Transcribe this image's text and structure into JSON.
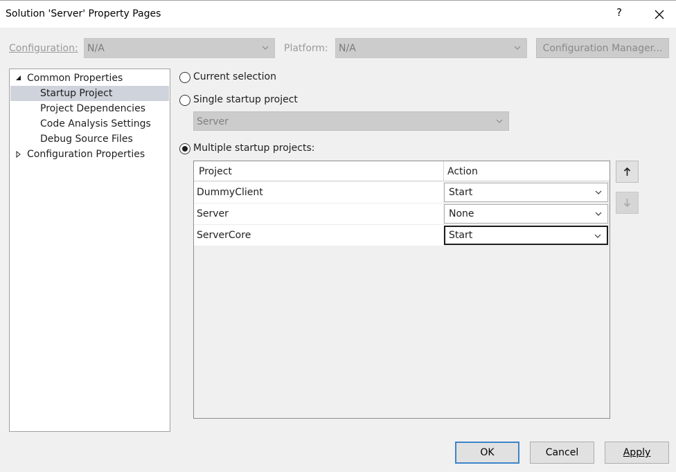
{
  "window": {
    "title": "Solution 'Server' Property Pages",
    "help": "?"
  },
  "config": {
    "configuration_label": "Configuration:",
    "configuration_value": "N/A",
    "platform_label": "Platform:",
    "platform_value": "N/A",
    "manager_label": "Configuration Manager..."
  },
  "tree": {
    "common_properties": "Common Properties",
    "items": [
      "Startup Project",
      "Project Dependencies",
      "Code Analysis Settings",
      "Debug Source Files"
    ],
    "configuration_properties": "Configuration Properties"
  },
  "startup": {
    "current_selection": "Current selection",
    "single_startup": "Single startup project",
    "single_value": "Server",
    "multiple_startup": "Multiple startup projects:",
    "selected_option": "multiple"
  },
  "grid": {
    "headers": {
      "project": "Project",
      "action": "Action"
    },
    "rows": [
      {
        "project": "DummyClient",
        "action": "Start"
      },
      {
        "project": "Server",
        "action": "None"
      },
      {
        "project": "ServerCore",
        "action": "Start"
      }
    ]
  },
  "buttons": {
    "ok": "OK",
    "cancel": "Cancel",
    "apply": "Apply"
  },
  "colors": {
    "selection": "#cfd3dc",
    "default_button_border": "#3c84c8",
    "disabled_fill": "#cccccc"
  }
}
